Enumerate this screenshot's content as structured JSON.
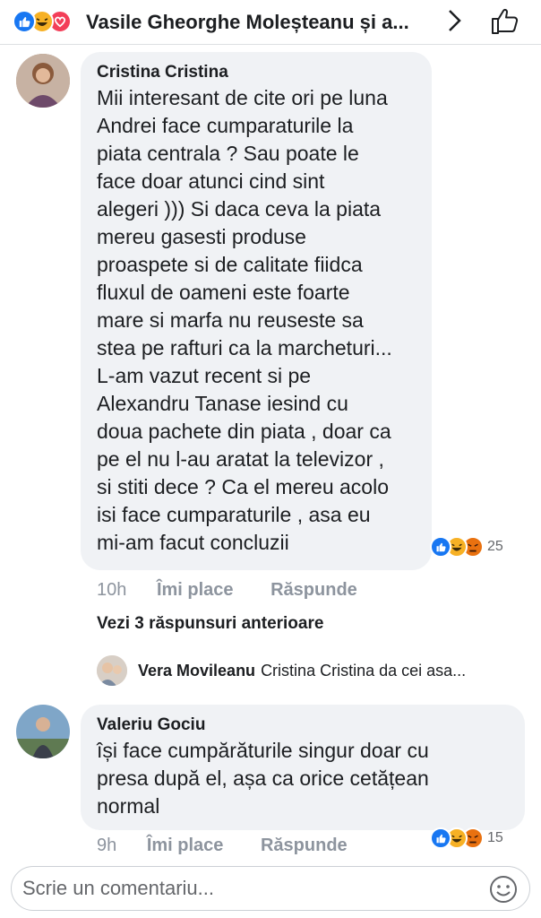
{
  "colors": {
    "like_blue": "#1877f2",
    "haha_yellow": "#f7b125",
    "love_red": "#f33e58",
    "angry_orange": "#e9710f",
    "bubble_gray": "#f0f2f5",
    "meta_gray": "#8d949e"
  },
  "header": {
    "title": "Vasile Gheorghe Molește­anu și a...",
    "reactions": [
      "like-icon",
      "haha-icon",
      "love-icon"
    ],
    "chevron_icon": "chevron-right-icon",
    "like_icon": "thumbs-up-outline-icon"
  },
  "comments": [
    {
      "author": "Cristina Cristina",
      "text": "Mii interesant de cite ori pe luna\nAndrei  face cumparaturile la\npiata centrala ? Sau poate le\nface doar atunci cind  sint\nalegeri ))) Si daca ceva la piata\nmereu gasesti produse\nproaspete si de calitate fiidca\nfluxul de oameni este foarte\nmare si marfa nu reuseste sa\nstea pe rafturi ca la marcheturi...\nL-am vazut recent si pe\nAlexandru Tanase iesind cu\ndoua pachete din piata , doar ca\npe el nu l-au aratat la televizor ,\nsi stiti dece ? Ca el mereu acolo\nisi face cumparaturile , asa eu\nmi-am facut concluzii",
      "time": "10h",
      "like_label": "Îmi place",
      "reply_label": "Răspunde",
      "reaction_count": "25",
      "reactions": [
        "like-icon",
        "haha-icon",
        "angry-icon"
      ]
    },
    {
      "author": "Valeriu Gociu",
      "text": "își face cumpărăturile singur doar cu\npresa după el, așa ca orice cetățean\nnormal",
      "time": "9h",
      "like_label": "Îmi place",
      "reply_label": "Răspunde",
      "reaction_count": "15",
      "reactions": [
        "like-icon",
        "haha-icon",
        "angry-icon"
      ]
    }
  ],
  "previous_replies_label": "Vezi 3 răspunsuri anterioare",
  "reply_preview": {
    "author": "Vera Movileanu",
    "text": "Cristina Cristina da cei asa..."
  },
  "footer": {
    "placeholder": "Scrie un comentariu...",
    "emoji_icon": "smiley-icon"
  }
}
